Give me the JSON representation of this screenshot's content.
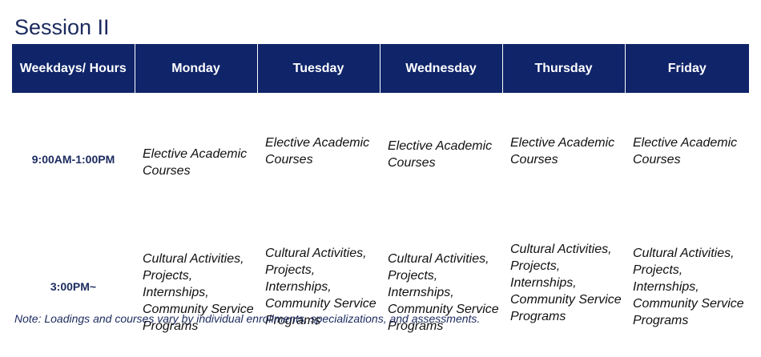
{
  "title": "Session II",
  "table": {
    "headers": [
      "Weekdays/ Hours",
      "Monday",
      "Tuesday",
      "Wednesday",
      "Thursday",
      "Friday"
    ],
    "rows": [
      {
        "time": "9:00AM-1:00PM",
        "cells": [
          "Elective Academic Courses",
          "Elective Academic Courses",
          "Elective Academic Courses",
          "Elective Academic Courses",
          "Elective Academic Courses"
        ]
      },
      {
        "time": "3:00PM~",
        "cells": [
          "Cultural Activities, Projects, Internships, Community Service Programs",
          "Cultural Activities, Projects, Internships, Community Service Programs",
          "Cultural Activities, Projects, Internships, Community Service Programs",
          "Cultural Activities, Projects, Internships, Community Service Programs",
          "Cultural Activities, Projects, Internships, Community Service Programs"
        ]
      }
    ]
  },
  "note": "Note: Loadings and courses vary by individual enrollments, specializations, and assessments."
}
